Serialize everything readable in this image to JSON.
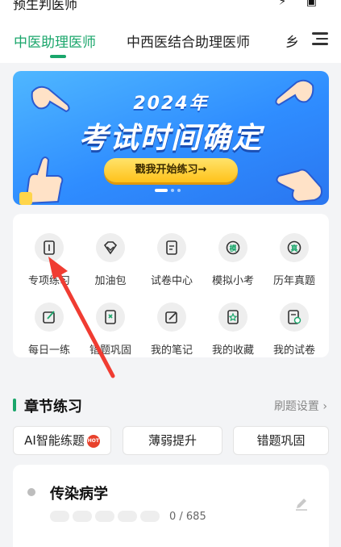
{
  "status_bar": {
    "text": "预生判医师",
    "icons": "⚡ ▣"
  },
  "nav": {
    "tabs": [
      {
        "label": "中医助理医师",
        "active": true
      },
      {
        "label": "中西医结合助理医师",
        "active": false
      },
      {
        "label": "乡",
        "active": false
      }
    ]
  },
  "banner": {
    "year": "2024年",
    "headline": "考试时间确定",
    "cta_label": "戳我开始练习→"
  },
  "grid": {
    "items": [
      {
        "label": "专项练习",
        "icon": "book-icon"
      },
      {
        "label": "加油包",
        "icon": "diamond-icon"
      },
      {
        "label": "试卷中心",
        "icon": "document-icon"
      },
      {
        "label": "模拟小考",
        "icon": "exam-icon"
      },
      {
        "label": "历年真题",
        "icon": "history-icon"
      },
      {
        "label": "每日一练",
        "icon": "pen-icon"
      },
      {
        "label": "错题巩固",
        "icon": "error-book-icon"
      },
      {
        "label": "我的笔记",
        "icon": "note-icon"
      },
      {
        "label": "我的收藏",
        "icon": "star-icon"
      },
      {
        "label": "我的试卷",
        "icon": "paper-icon"
      }
    ]
  },
  "section": {
    "title": "章节练习",
    "settings_label": "刷题设置 ›"
  },
  "filters": [
    {
      "label": "AI智能练题",
      "badge": "HOT"
    },
    {
      "label": "薄弱提升"
    },
    {
      "label": "错题巩固"
    }
  ],
  "chapter": {
    "name": "传染病学",
    "progress_text": "0 / 685",
    "progress_fraction": 0
  },
  "colors": {
    "accent": "#1aa66b",
    "banner": "#2f8dff",
    "cta": "#ffc21a",
    "arrow": "#f03c32"
  }
}
